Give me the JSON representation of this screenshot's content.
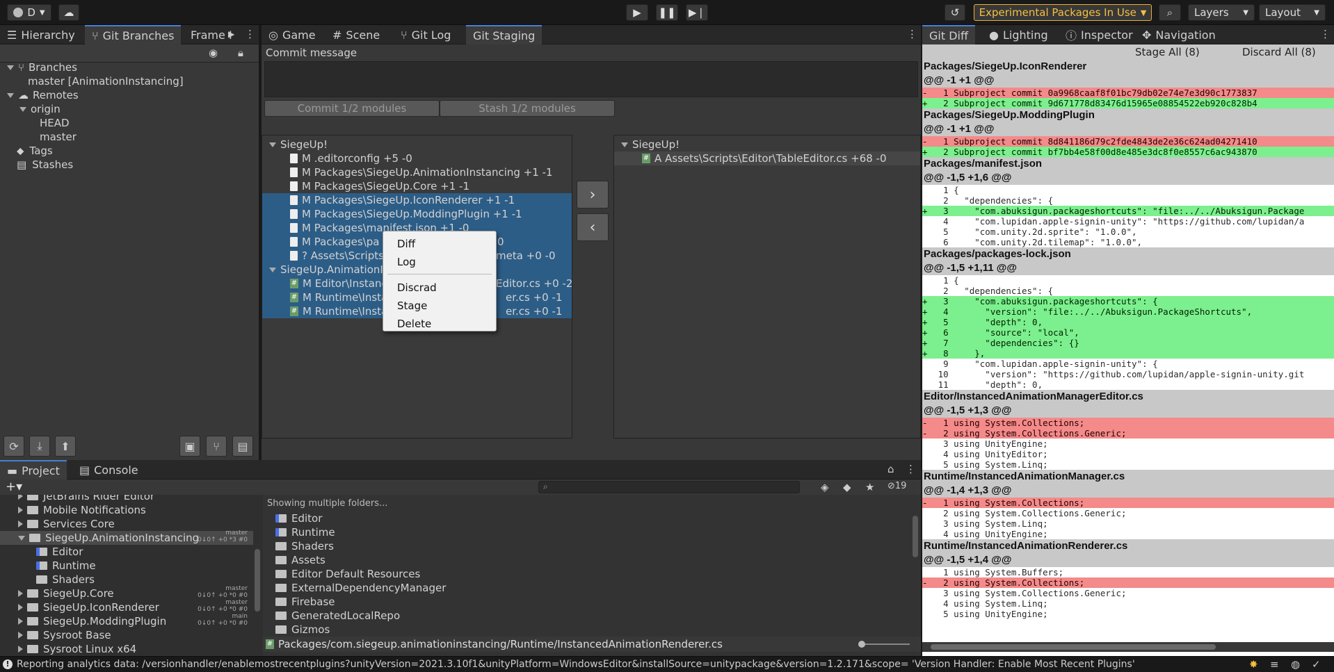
{
  "toolbar": {
    "account": "D",
    "experimental": "Experimental Packages In Use",
    "layers": "Layers",
    "layout": "Layout"
  },
  "tabs_left": [
    "Hierarchy",
    "Git Branches",
    "Frame I"
  ],
  "tabs_center": [
    "Game",
    "Scene",
    "Git Log",
    "Git Staging"
  ],
  "tabs_right": [
    "Git Diff",
    "Lighting",
    "Inspector",
    "Navigation"
  ],
  "branches": {
    "branches": "Branches",
    "current": "master  [AnimationInstancing]",
    "remotes": "Remotes",
    "origin": "origin",
    "head": "HEAD",
    "master": "master",
    "tags": "Tags",
    "stashes": "Stashes"
  },
  "staging": {
    "commit_label": "Commit message",
    "commit_btn": "Commit 1/2 modules",
    "stash_btn": "Stash 1/2 modules",
    "unstaged": [
      "SiegeUp!",
      "M .editorconfig +5 -0",
      "M Packages\\SiegeUp.AnimationInstancing +1 -1",
      "M Packages\\SiegeUp.Core +1 -1",
      "M Packages\\SiegeUp.IconRenderer +1 -1",
      "M Packages\\SiegeUp.ModdingPlugin +1 -1",
      "M Packages\\manifest.json +1 -0",
      "M Packages\\pa",
      "0",
      "? Assets\\Scripts",
      "meta +0 -0",
      "SiegeUp.AnimationIns",
      "M Editor\\Instanc",
      "Editor.cs +0 -2",
      "M Runtime\\Insta",
      "er.cs +0 -1",
      "M Runtime\\Insta",
      "er.cs +0 -1"
    ],
    "staged": [
      "SiegeUp!",
      "A Assets\\Scripts\\Editor\\TableEditor.cs +68 -0"
    ]
  },
  "context_menu": [
    "Diff",
    "Log",
    "Discrad",
    "Stage",
    "Delete"
  ],
  "diff": {
    "stage_all": "Stage All (8)",
    "discard_all": "Discard All (8)",
    "lines": [
      [
        "h",
        "Packages/SiegeUp.IconRenderer"
      ],
      [
        "h",
        "@@ -1 +1 @@"
      ],
      [
        "r",
        "-   1 Subproject commit 0a9968caaf8f01bc79db02e74e7e3d90c1773837"
      ],
      [
        "a",
        "+   2 Subproject commit 9d671778d83476d15965e08854522eb920c828b4"
      ],
      [
        "h",
        "Packages/SiegeUp.ModdingPlugin"
      ],
      [
        "h",
        "@@ -1 +1 @@"
      ],
      [
        "r",
        "-   1 Subproject commit 8d841186d79c2fde4843de2e36c624ad04271410"
      ],
      [
        "a",
        "+   2 Subproject commit bf7bb4e58f00d8e485e3dc8f0e8557c6ac943870"
      ],
      [
        "h",
        "Packages/manifest.json"
      ],
      [
        "h",
        "@@ -1,5 +1,6 @@"
      ],
      [
        "c",
        "    1 {"
      ],
      [
        "c",
        "    2   \"dependencies\": {"
      ],
      [
        "a",
        "+   3     \"com.abuksigun.packageshortcuts\": \"file:../../Abuksigun.Package"
      ],
      [
        "c",
        "    4     \"com.lupidan.apple-signin-unity\": \"https://github.com/lupidan/a"
      ],
      [
        "c",
        "    5     \"com.unity.2d.sprite\": \"1.0.0\","
      ],
      [
        "c",
        "    6     \"com.unity.2d.tilemap\": \"1.0.0\","
      ],
      [
        "h",
        "Packages/packages-lock.json"
      ],
      [
        "h",
        "@@ -1,5 +1,11 @@"
      ],
      [
        "c",
        "    1 {"
      ],
      [
        "c",
        "    2   \"dependencies\": {"
      ],
      [
        "a",
        "+   3     \"com.abuksigun.packageshortcuts\": {"
      ],
      [
        "a",
        "+   4       \"version\": \"file:../../Abuksigun.PackageShortcuts\","
      ],
      [
        "a",
        "+   5       \"depth\": 0,"
      ],
      [
        "a",
        "+   6       \"source\": \"local\","
      ],
      [
        "a",
        "+   7       \"dependencies\": {}"
      ],
      [
        "a",
        "+   8     },"
      ],
      [
        "c",
        "    9     \"com.lupidan.apple-signin-unity\": {"
      ],
      [
        "c",
        "   10       \"version\": \"https://github.com/lupidan/apple-signin-unity.git"
      ],
      [
        "c",
        "   11       \"depth\": 0,"
      ],
      [
        "h",
        "Editor/InstancedAnimationManagerEditor.cs"
      ],
      [
        "h",
        "@@ -1,5 +1,3 @@"
      ],
      [
        "r",
        "-   1 using System.Collections;"
      ],
      [
        "r",
        "-   2 using System.Collections.Generic;"
      ],
      [
        "c",
        "    3 using UnityEngine;"
      ],
      [
        "c",
        "    4 using UnityEditor;"
      ],
      [
        "c",
        "    5 using System.Linq;"
      ],
      [
        "h",
        "Runtime/InstancedAnimationManager.cs"
      ],
      [
        "h",
        "@@ -1,4 +1,3 @@"
      ],
      [
        "r",
        "-   1 using System.Collections;"
      ],
      [
        "c",
        "    2 using System.Collections.Generic;"
      ],
      [
        "c",
        "    3 using System.Linq;"
      ],
      [
        "c",
        "    4 using UnityEngine;"
      ],
      [
        "h",
        "Runtime/InstancedAnimationRenderer.cs"
      ],
      [
        "h",
        "@@ -1,5 +1,4 @@"
      ],
      [
        "c",
        "    1 using System.Buffers;"
      ],
      [
        "r",
        "-   2 using System.Collections;"
      ],
      [
        "c",
        "    3 using System.Collections.Generic;"
      ],
      [
        "c",
        "    4 using System.Linq;"
      ],
      [
        "c",
        "    5 using UnityEngine;"
      ]
    ]
  },
  "bottom_tabs": [
    "Project",
    "Console"
  ],
  "project_tree": [
    {
      "label": "JetBrains Rider Editor",
      "indent": 1
    },
    {
      "label": "Mobile Notifications",
      "indent": 1
    },
    {
      "label": "Services Core",
      "indent": 1
    },
    {
      "label": "SiegeUp.AnimationInstancing",
      "indent": 1,
      "open": true,
      "sel": true,
      "branch": "master",
      "stats": "0↓0↑ +0 *3 #0"
    },
    {
      "label": "Editor",
      "indent": 2,
      "blue": true
    },
    {
      "label": "Runtime",
      "indent": 2,
      "blue": true
    },
    {
      "label": "Shaders",
      "indent": 2
    },
    {
      "label": "SiegeUp.Core",
      "indent": 1,
      "branch": "master",
      "stats": "0↓0↑ +0 *0 #0"
    },
    {
      "label": "SiegeUp.IconRenderer",
      "indent": 1,
      "branch": "master",
      "stats": "0↓0↑ +0 *0 #0"
    },
    {
      "label": "SiegeUp.ModdingPlugin",
      "indent": 1,
      "branch": "main",
      "stats": "0↓0↑ +0 *0 #0"
    },
    {
      "label": "Sysroot Base",
      "indent": 1
    },
    {
      "label": "Sysroot Linux x64",
      "indent": 1
    }
  ],
  "project_list": {
    "header": "Showing multiple folders...",
    "items": [
      {
        "n": "Editor",
        "b": true
      },
      {
        "n": "Runtime",
        "b": true
      },
      {
        "n": "Shaders"
      },
      {
        "n": "Assets"
      },
      {
        "n": "Editor Default Resources"
      },
      {
        "n": "ExternalDependencyManager"
      },
      {
        "n": "Firebase"
      },
      {
        "n": "GeneratedLocalRepo"
      },
      {
        "n": "Gizmos"
      }
    ],
    "path": "Packages/com.siegeup.animationinstancing/Runtime/InstancedAnimationRenderer.cs",
    "hidden_count": "19"
  },
  "status": "Reporting analytics data: /versionhandler/enablemostrecentplugins?unityVersion=2021.3.10f1&unityPlatform=WindowsEditor&installSource=unitypackage&version=1.2.171&scope= 'Version Handler: Enable Most Recent Plugins'"
}
